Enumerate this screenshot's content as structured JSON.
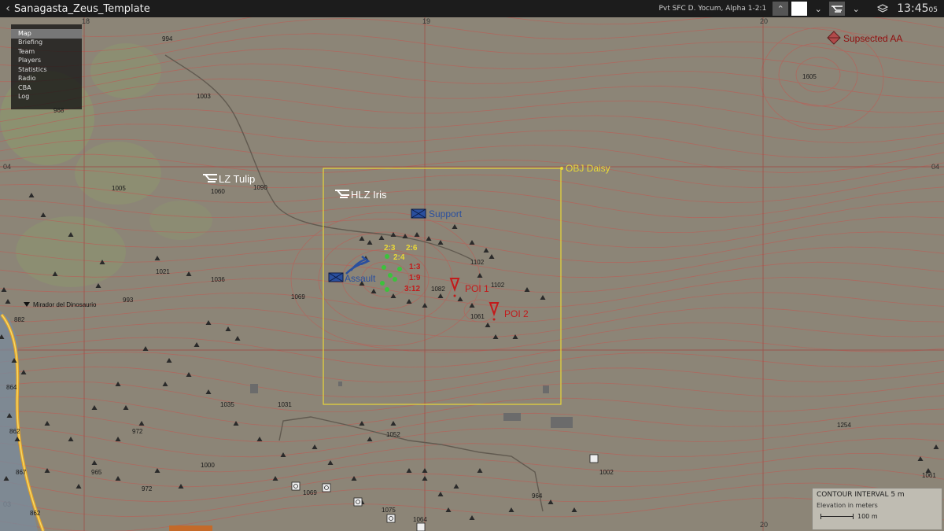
{
  "window": {
    "title": "Sanagasta_Zeus_Template",
    "player": "Pvt SFC D. Yocum, Alpha 1-2:1",
    "time_main": "13:45",
    "time_sec": "05"
  },
  "menu": {
    "items": [
      "Map",
      "Briefing",
      "Team",
      "Players",
      "Statistics",
      "Radio",
      "CBA",
      "Log"
    ],
    "active": "Map"
  },
  "grid_labels": {
    "top": [
      "18",
      "19",
      "20"
    ],
    "left": [
      "04",
      "03"
    ],
    "right": [
      "04"
    ],
    "bottom": [
      "20"
    ]
  },
  "markers": {
    "obj": "OBJ Daisy",
    "lz": "LZ Tulip",
    "hlz": "HLZ Iris",
    "support": "Support",
    "assault": "Assault",
    "poi1": "POI 1",
    "poi2": "POI 2",
    "aa": "Supsected AA",
    "mirador": "Mirador del Dinosaurio",
    "squad_yellow": [
      "2:3",
      "2:4",
      "2:6"
    ],
    "squad_red": [
      "1:3",
      "1:9",
      "3:12"
    ]
  },
  "elevations": [
    "994",
    "1003",
    "968",
    "1005",
    "1060",
    "1090",
    "1021",
    "1036",
    "993",
    "1069",
    "882",
    "1102",
    "1102",
    "1082",
    "1061",
    "1605",
    "1035",
    "1031",
    "972",
    "864",
    "862",
    "1052",
    "965",
    "1000",
    "972",
    "867",
    "1069",
    "1075",
    "1064",
    "964",
    "1002",
    "1254",
    "1061",
    "862"
  ],
  "legend": {
    "title": "CONTOUR INTERVAL 5 m",
    "subtitle": "Elevation in meters",
    "scale": "100 m"
  },
  "colors": {
    "background": "#8c8577",
    "contour": "#b86058",
    "grid": "#a04a44",
    "objective": "#e8d838",
    "friendly": "#2a4f9e",
    "enemy": "#c21b1b"
  }
}
